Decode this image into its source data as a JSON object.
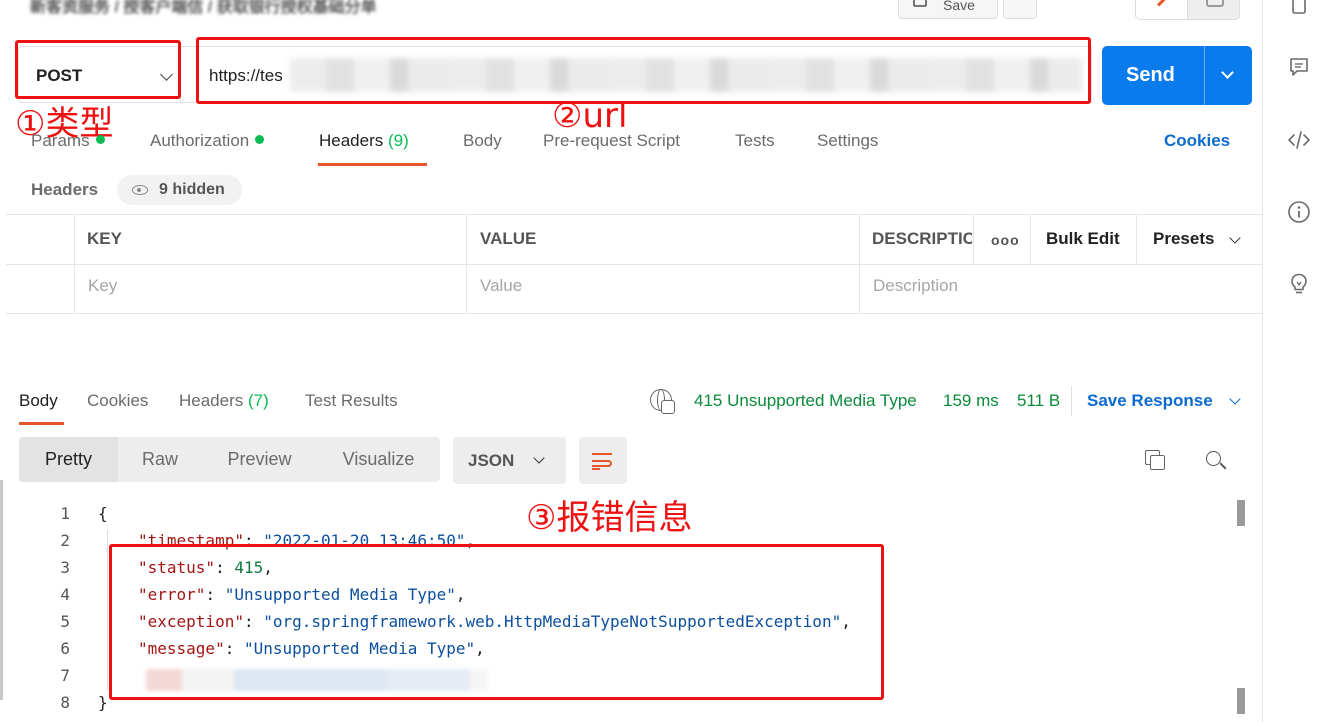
{
  "header": {
    "breadcrumb": "新客资服务 / 授客户端信 / 获取银行授权基础分单",
    "save_label": "Save"
  },
  "request": {
    "method": "POST",
    "url_visible": "https://tes",
    "send_label": "Send"
  },
  "annotations": {
    "type_label": "①类型",
    "url_label": "②url",
    "error_label": "③报错信息"
  },
  "request_tabs": {
    "params": "Params",
    "authorization": "Authorization",
    "headers": "Headers",
    "headers_count": "(9)",
    "body": "Body",
    "prerequest": "Pre-request Script",
    "tests": "Tests",
    "settings": "Settings",
    "cookies": "Cookies"
  },
  "headers_panel": {
    "label": "Headers",
    "hidden": "9 hidden",
    "columns": {
      "key": "KEY",
      "value": "VALUE",
      "description": "DESCRIPTIC",
      "bulk_edit": "Bulk Edit",
      "presets": "Presets"
    },
    "placeholders": {
      "key": "Key",
      "value": "Value",
      "description": "Description"
    }
  },
  "response_tabs": {
    "body": "Body",
    "cookies": "Cookies",
    "headers": "Headers",
    "headers_count": "(7)",
    "test_results": "Test Results"
  },
  "response_status": {
    "status": "415 Unsupported Media Type",
    "time": "159 ms",
    "size": "511 B",
    "save_response": "Save Response"
  },
  "response_view": {
    "modes": [
      "Pretty",
      "Raw",
      "Preview",
      "Visualize"
    ],
    "format": "JSON"
  },
  "response_body": {
    "line_numbers": [
      "1",
      "2",
      "3",
      "4",
      "5",
      "6",
      "7",
      "8"
    ],
    "open_brace": "{",
    "close_brace": "}",
    "timestamp_key": "\"timestamp\"",
    "timestamp_val": "\"2022-01-20 13:46:50\"",
    "status_key": "\"status\"",
    "status_val": "415",
    "error_key": "\"error\"",
    "error_val": "\"Unsupported Media Type\"",
    "exception_key": "\"exception\"",
    "exception_val": "\"org.springframework.web.HttpMediaTypeNotSupportedException\"",
    "message_key": "\"message\"",
    "message_val": "\"Unsupported Media Type\""
  },
  "colors": {
    "accent_orange": "#e8542c",
    "send_blue": "#097bed",
    "link_blue": "#0b6bcf",
    "status_green": "#0b8a3c",
    "annotation_red": "#ee1111"
  }
}
